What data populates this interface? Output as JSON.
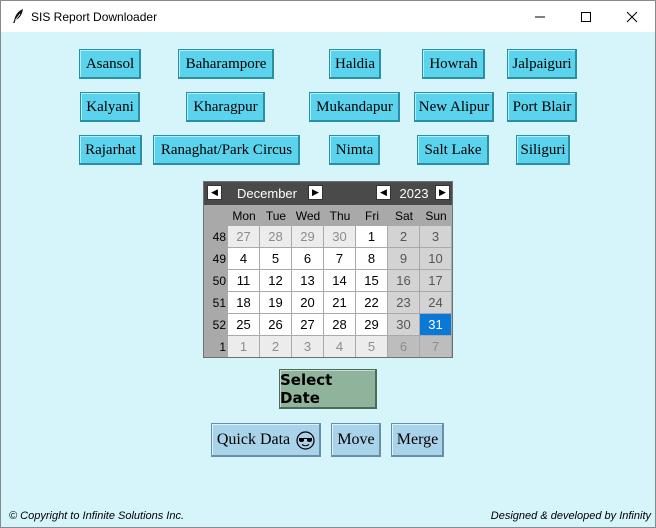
{
  "window": {
    "title": "SIS Report Downloader"
  },
  "cities": {
    "row1": [
      "Asansol",
      "Baharampore",
      "Haldia",
      "Howrah",
      "Jalpaiguri"
    ],
    "row2": [
      "Kalyani",
      "Kharagpur",
      "Mukandapur",
      "New Alipur",
      "Port Blair"
    ],
    "row3": [
      "Rajarhat",
      "Ranaghat/Park Circus",
      "Nimta",
      "Salt Lake",
      "Siliguri"
    ]
  },
  "calendar": {
    "month": "December",
    "year": "2023",
    "weekdays": [
      "Mon",
      "Tue",
      "Wed",
      "Thu",
      "Fri",
      "Sat",
      "Sun"
    ],
    "weeks": [
      {
        "num": "48",
        "days": [
          "27",
          "28",
          "29",
          "30",
          "1",
          "2",
          "3"
        ]
      },
      {
        "num": "49",
        "days": [
          "4",
          "5",
          "6",
          "7",
          "8",
          "9",
          "10"
        ]
      },
      {
        "num": "50",
        "days": [
          "11",
          "12",
          "13",
          "14",
          "15",
          "16",
          "17"
        ]
      },
      {
        "num": "51",
        "days": [
          "18",
          "19",
          "20",
          "21",
          "22",
          "23",
          "24"
        ]
      },
      {
        "num": "52",
        "days": [
          "25",
          "26",
          "27",
          "28",
          "29",
          "30",
          "31"
        ]
      },
      {
        "num": "1",
        "days": [
          "1",
          "2",
          "3",
          "4",
          "5",
          "6",
          "7"
        ]
      }
    ],
    "selected_day": "31"
  },
  "buttons": {
    "select_date": "Select Date",
    "quick_data": "Quick Data",
    "move": "Move",
    "merge": "Merge"
  },
  "footer": {
    "left": "© Copyright to Infinite Solutions Inc.",
    "right": "Designed & developed by Infinity"
  },
  "colors": {
    "background": "#d6f5fa",
    "city_button": "#5bd3ec",
    "select_button": "#8fb39b",
    "action_button": "#a9d3e8",
    "selected_day": "#0a78d7"
  }
}
